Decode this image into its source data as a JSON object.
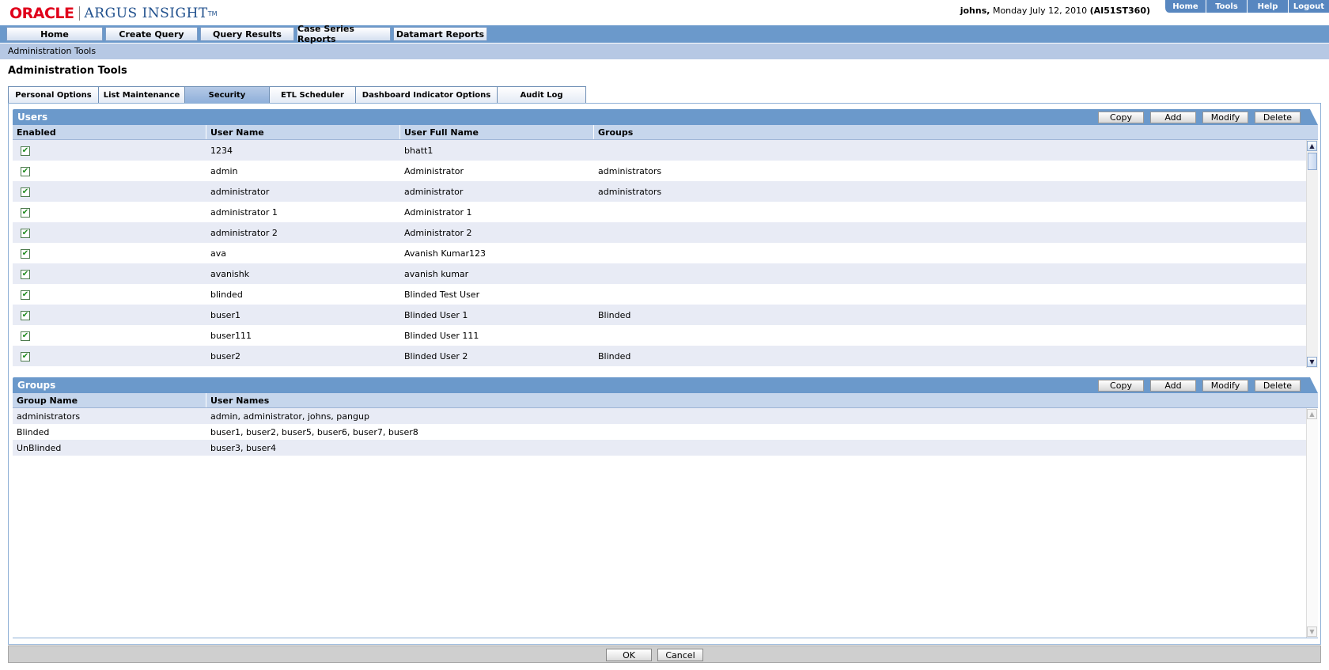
{
  "header": {
    "logo_oracle": "ORACLE",
    "logo_product": "ARGUS INSIGHT",
    "logo_tm": "TM",
    "user": "johns,",
    "date": "Monday July 12, 2010",
    "server": "(AI51ST360)",
    "links": [
      "Home",
      "Tools",
      "Help",
      "Logout"
    ]
  },
  "nav": [
    "Home",
    "Create Query",
    "Query Results",
    "Case Series Reports",
    "Datamart Reports"
  ],
  "breadcrumb": "Administration Tools",
  "page_title": "Administration Tools",
  "tabs": [
    "Personal Options",
    "List Maintenance",
    "Security",
    "ETL Scheduler",
    "Dashboard Indicator Options",
    "Audit Log"
  ],
  "active_tab": "Security",
  "users_panel": {
    "title": "Users",
    "buttons": [
      "Copy",
      "Add",
      "Modify",
      "Delete"
    ],
    "columns": [
      "Enabled",
      "User Name",
      "User Full Name",
      "Groups"
    ],
    "rows": [
      {
        "enabled": true,
        "user": "1234",
        "full": "bhatt1",
        "groups": ""
      },
      {
        "enabled": true,
        "user": "admin",
        "full": "Administrator",
        "groups": "administrators"
      },
      {
        "enabled": true,
        "user": "administrator",
        "full": "administrator",
        "groups": "administrators"
      },
      {
        "enabled": true,
        "user": "administrator 1",
        "full": "Administrator 1",
        "groups": ""
      },
      {
        "enabled": true,
        "user": "administrator 2",
        "full": "Administrator 2",
        "groups": ""
      },
      {
        "enabled": true,
        "user": "ava",
        "full": "Avanish Kumar123",
        "groups": ""
      },
      {
        "enabled": true,
        "user": "avanishk",
        "full": "avanish kumar",
        "groups": ""
      },
      {
        "enabled": true,
        "user": "blinded",
        "full": "Blinded Test User",
        "groups": ""
      },
      {
        "enabled": true,
        "user": "buser1",
        "full": "Blinded User 1",
        "groups": "Blinded"
      },
      {
        "enabled": true,
        "user": "buser111",
        "full": "Blinded User 111",
        "groups": ""
      },
      {
        "enabled": true,
        "user": "buser2",
        "full": "Blinded User 2",
        "groups": "Blinded"
      }
    ]
  },
  "groups_panel": {
    "title": "Groups",
    "buttons": [
      "Copy",
      "Add",
      "Modify",
      "Delete"
    ],
    "columns": [
      "Group Name",
      "User Names"
    ],
    "rows": [
      {
        "group": "administrators",
        "users": "admin, administrator, johns, pangup"
      },
      {
        "group": "Blinded",
        "users": "buser1, buser2, buser5, buser6, buser7, buser8"
      },
      {
        "group": "UnBlinded",
        "users": "buser3, buser4"
      }
    ]
  },
  "footer": {
    "ok": "OK",
    "cancel": "Cancel"
  },
  "icons": {
    "check": "checkmark-icon",
    "scroll_up": "chevron-up-icon",
    "scroll_down": "chevron-down-icon"
  }
}
